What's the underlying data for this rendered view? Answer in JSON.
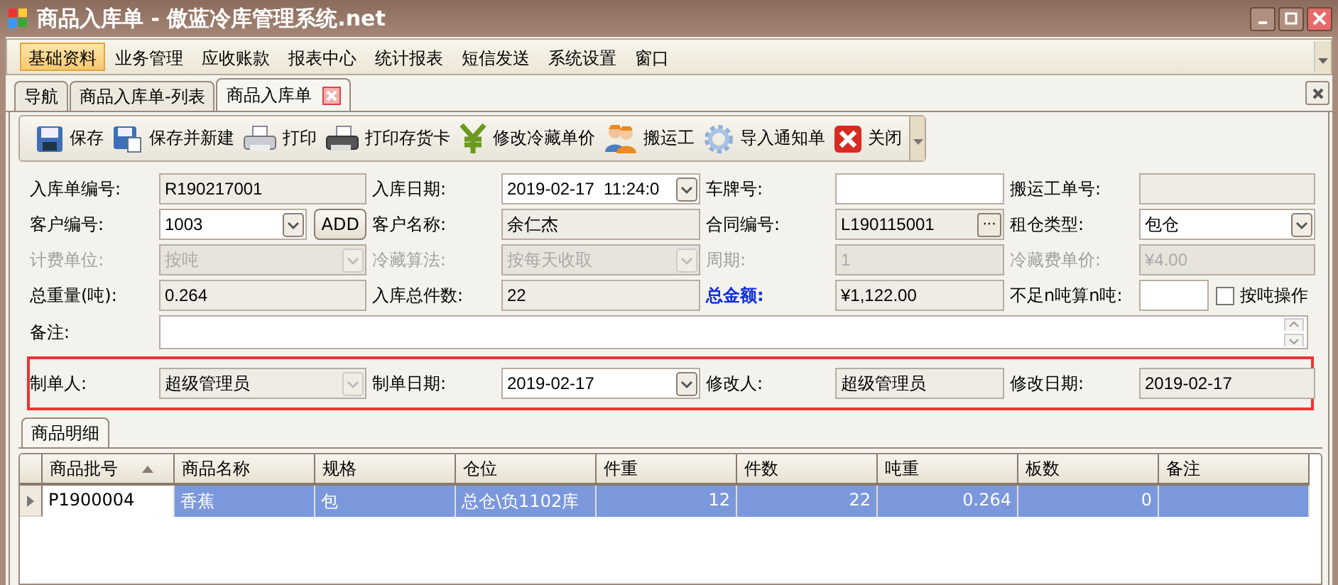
{
  "window": {
    "title": "商品入库单 - 傲蓝冷库管理系统.net"
  },
  "menu": [
    {
      "label": "基础资料",
      "selected": true
    },
    {
      "label": "业务管理",
      "selected": false
    },
    {
      "label": "应收账款",
      "selected": false
    },
    {
      "label": "报表中心",
      "selected": false
    },
    {
      "label": "统计报表",
      "selected": false
    },
    {
      "label": "短信发送",
      "selected": false
    },
    {
      "label": "系统设置",
      "selected": false
    },
    {
      "label": "窗口",
      "selected": false
    }
  ],
  "tabs": [
    {
      "label": "导航",
      "selected": false,
      "closable": false
    },
    {
      "label": "商品入库单-列表",
      "selected": false,
      "closable": false
    },
    {
      "label": "商品入库单",
      "selected": true,
      "closable": true
    }
  ],
  "toolbar": [
    {
      "label": "保存",
      "kind": "save"
    },
    {
      "label": "保存并新建",
      "kind": "save-new"
    },
    {
      "label": "打印",
      "kind": "print"
    },
    {
      "label": "打印存货卡",
      "kind": "print-card"
    },
    {
      "label": "修改冷藏单价",
      "kind": "price"
    },
    {
      "label": "搬运工",
      "kind": "workers"
    },
    {
      "label": "导入通知单",
      "kind": "import"
    },
    {
      "label": "关闭",
      "kind": "close"
    }
  ],
  "form": {
    "rows": [
      {
        "highlighted": false,
        "fields": [
          {
            "label": "入库单编号:",
            "kind": "readonly",
            "value": "R190217001",
            "disabled": false,
            "emphasized": false
          },
          {
            "label": "入库日期:",
            "kind": "combo",
            "editable": true,
            "value": "2019-02-17  11:24:0",
            "disabled": false,
            "emphasized": false
          },
          {
            "label": "车牌号:",
            "kind": "input",
            "disabled": false,
            "emphasized": false
          },
          {
            "label": "搬运工单号:",
            "kind": "readonly",
            "disabled": false,
            "emphasized": false
          }
        ]
      },
      {
        "highlighted": false,
        "fields": [
          {
            "label": "客户编号:",
            "kind": "combo",
            "editable": true,
            "value": "1003",
            "button": "ADD",
            "disabled": false,
            "emphasized": false
          },
          {
            "label": "客户名称:",
            "kind": "readonly",
            "value": "余仁杰",
            "disabled": false,
            "emphasized": false
          },
          {
            "label": "合同编号:",
            "kind": "lookup",
            "value": "L190115001",
            "button": "···",
            "disabled": false,
            "emphasized": false
          },
          {
            "label": "租仓类型:",
            "kind": "combo",
            "editable": true,
            "value": "包仓",
            "disabled": false,
            "emphasized": false
          }
        ]
      },
      {
        "highlighted": false,
        "fields": [
          {
            "label": "计费单位:",
            "kind": "combo",
            "editable": false,
            "value": "按吨",
            "disabled": true,
            "emphasized": false
          },
          {
            "label": "冷藏算法:",
            "kind": "combo",
            "editable": false,
            "value": "按每天收取",
            "disabled": true,
            "emphasized": false
          },
          {
            "label": "周期:",
            "kind": "readonly",
            "value": "1",
            "disabled": true,
            "emphasized": false
          },
          {
            "label": "冷藏费单价:",
            "kind": "readonly",
            "value": "¥4.00",
            "disabled": true,
            "emphasized": false
          }
        ]
      },
      {
        "highlighted": false,
        "fields": [
          {
            "label": "总重量(吨):",
            "kind": "readonly",
            "value": "0.264",
            "disabled": false,
            "emphasized": false
          },
          {
            "label": "入库总件数:",
            "kind": "readonly",
            "value": "22",
            "disabled": false,
            "emphasized": false
          },
          {
            "label": "总金额:",
            "kind": "readonly",
            "value": "¥1,122.00",
            "disabled": false,
            "emphasized": true
          },
          {
            "label": "不足n吨算n吨:",
            "kind": "input",
            "checkbox": {
              "label": "按吨操作",
              "checked": false
            },
            "disabled": false,
            "emphasized": false
          }
        ]
      },
      {
        "highlighted": false,
        "fields": [
          {
            "label": "备注:",
            "kind": "textarea",
            "disabled": false,
            "emphasized": false
          }
        ]
      },
      {
        "highlighted": true,
        "fields": [
          {
            "label": "制单人:",
            "kind": "combo",
            "editable": false,
            "value": "超级管理员",
            "disabled": false,
            "emphasized": false
          },
          {
            "label": "制单日期:",
            "kind": "combo",
            "editable": true,
            "value": "2019-02-17",
            "disabled": false,
            "emphasized": false
          },
          {
            "label": "修改人:",
            "kind": "readonly",
            "value": "超级管理员",
            "disabled": false,
            "emphasized": false
          },
          {
            "label": "修改日期:",
            "kind": "readonly",
            "value": "2019-02-17",
            "disabled": false,
            "emphasized": false
          }
        ]
      }
    ]
  },
  "detail_tab": {
    "label": "商品明细",
    "selected": true
  },
  "table": {
    "columns": [
      {
        "label": "商品批号",
        "sorted": true
      },
      {
        "label": "商品名称",
        "sorted": false
      },
      {
        "label": "规格",
        "sorted": false
      },
      {
        "label": "仓位",
        "sorted": false
      },
      {
        "label": "件重",
        "sorted": false
      },
      {
        "label": "件数",
        "sorted": false
      },
      {
        "label": "吨重",
        "sorted": false
      },
      {
        "label": "板数",
        "sorted": false
      },
      {
        "label": "备注",
        "sorted": false
      }
    ],
    "rows": [
      {
        "selected": true,
        "current": true,
        "cells": [
          {
            "text": "P1900004",
            "focused": true
          },
          {
            "text": "香蕉",
            "focused": false
          },
          {
            "text": "包",
            "focused": false
          },
          {
            "text": "总仓\\负1102库",
            "focused": false
          },
          {
            "text": "12",
            "focused": false
          },
          {
            "text": "22",
            "focused": false
          },
          {
            "text": "0.264",
            "focused": false
          },
          {
            "text": "0",
            "focused": false
          },
          {
            "focused": false
          }
        ]
      }
    ]
  }
}
